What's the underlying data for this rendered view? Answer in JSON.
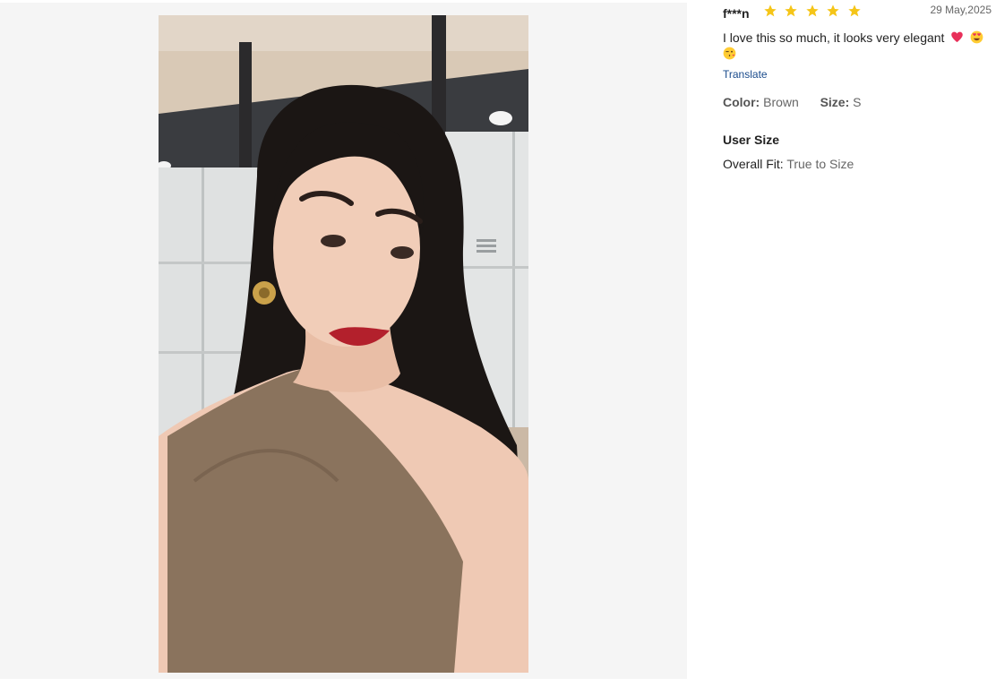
{
  "gallery": {
    "photo": {
      "subject": "selfie of a customer wearing the brown one-shoulder top",
      "colors": {
        "background": "#f5f5f5",
        "wall": "#d9c9b6",
        "lockers": "#dfe1e1",
        "top": "#8a735d",
        "hair": "#1b1614",
        "skin": "#efc9b4",
        "lips": "#b3202c"
      }
    }
  },
  "review": {
    "username": "f***n",
    "rating": 5,
    "rating_max": 5,
    "star_color": "#f5c518",
    "date": "29 May,2025",
    "text": "I love this so much, it looks very elegant",
    "emojis": [
      "heart-emoji",
      "heart-eyes-emoji",
      "kissing-face-emoji"
    ],
    "translate_label": "Translate",
    "color_label": "Color:",
    "color_value": "Brown",
    "size_label": "Size:",
    "size_value": "S",
    "user_size_title": "User Size",
    "overall_fit_label": "Overall Fit:",
    "overall_fit_value": "True to Size"
  }
}
